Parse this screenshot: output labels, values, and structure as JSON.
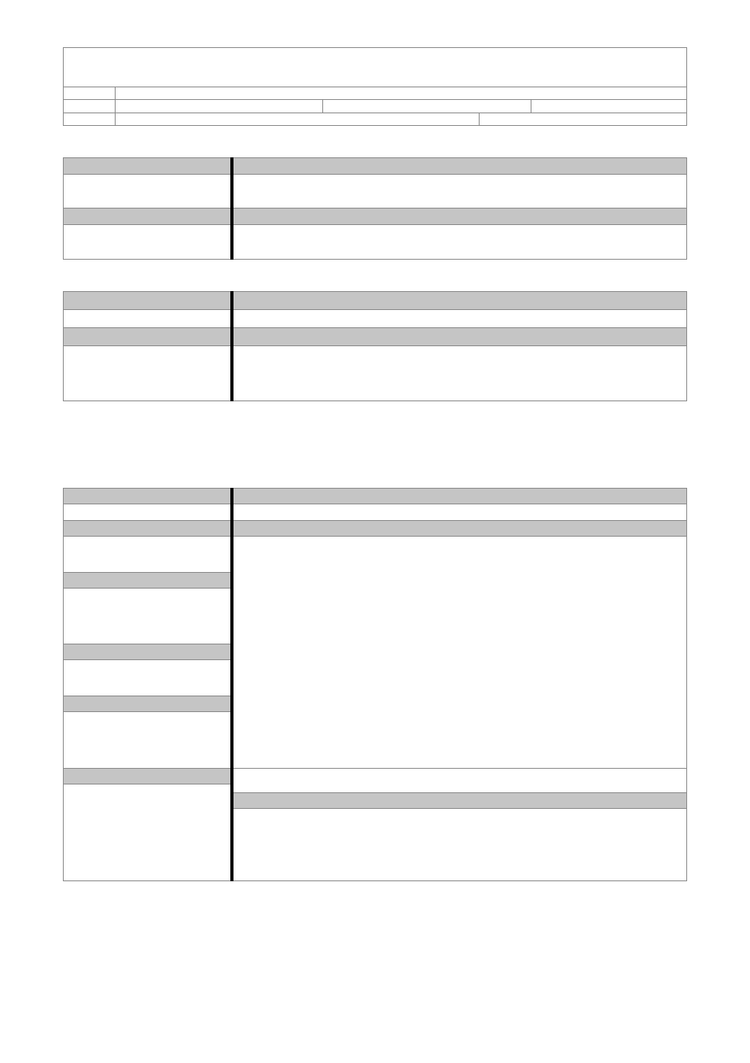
{
  "tables": {
    "t1": {
      "row2_c1": "",
      "row2_c2": "",
      "row3_c1": "",
      "row3_c2": "",
      "row3_c3": "",
      "row3_c4": "",
      "row4_c1": "",
      "row4_c2": "",
      "row4_c3": ""
    },
    "t2": {
      "r1c1": "",
      "r1c2": "",
      "r2c1": "",
      "r2c2": "",
      "r3c1": "",
      "r3c2": "",
      "r4c1": "",
      "r4c2": ""
    },
    "t3": {
      "r1c1": "",
      "r1c2": "",
      "r2c1": "",
      "r2c2": "",
      "r3c1": "",
      "r3c2": "",
      "r4c1": "",
      "r4c2": ""
    },
    "t4": {
      "r1c1": "",
      "r1c2": "",
      "r2c1": "",
      "r2c2": "",
      "r3c1": "",
      "r3c2": "",
      "r4c1": "",
      "r5c1": "",
      "r6c1": "",
      "r7c1": "",
      "r8c1": "",
      "r9c1": "",
      "r10c1": "",
      "r11c1": "",
      "nested_top": "",
      "nested_gray": "",
      "nested_bottom": "",
      "merged_right": ""
    }
  }
}
